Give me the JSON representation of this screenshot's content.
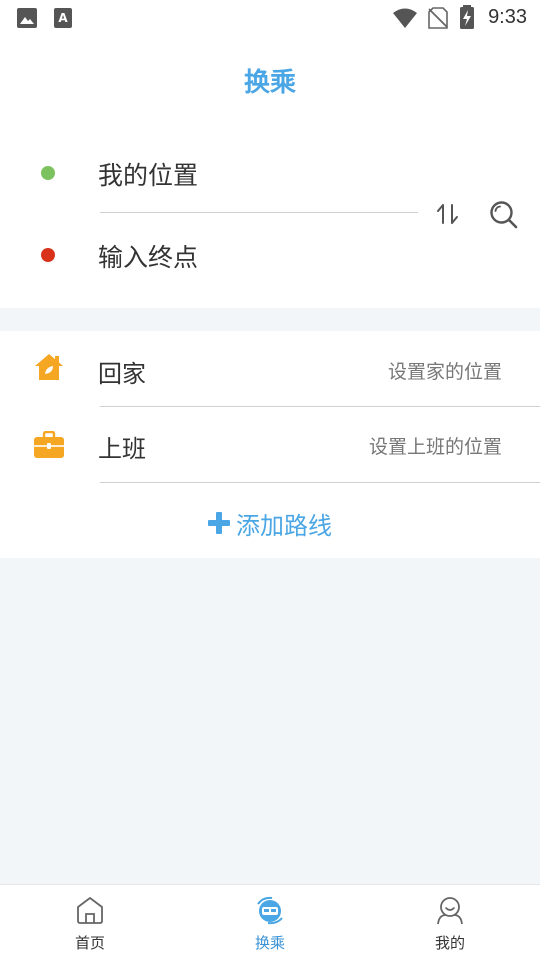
{
  "status_bar": {
    "time": "9:33",
    "icons": [
      "image-icon",
      "font-icon",
      "wifi-icon",
      "no-sim-icon",
      "battery-charging-icon"
    ]
  },
  "header": {
    "title": "换乘"
  },
  "route": {
    "start": "我的位置",
    "end": "输入终点",
    "start_color": "#7cc25e",
    "end_color": "#d9321a"
  },
  "shortcuts": {
    "items": [
      {
        "label": "回家",
        "hint": "设置家的位置",
        "icon": "home-icon",
        "color": "#f5a623"
      },
      {
        "label": "上班",
        "hint": "设置上班的位置",
        "icon": "briefcase-icon",
        "color": "#f5a623"
      }
    ],
    "add_label": "添加路线"
  },
  "nav": {
    "items": [
      {
        "label": "首页",
        "icon": "home-outline-icon"
      },
      {
        "label": "换乘",
        "icon": "transfer-icon",
        "active": true
      },
      {
        "label": "我的",
        "icon": "user-icon"
      }
    ]
  },
  "colors": {
    "accent": "#4aa6e4",
    "background": "#f3f6f9"
  }
}
